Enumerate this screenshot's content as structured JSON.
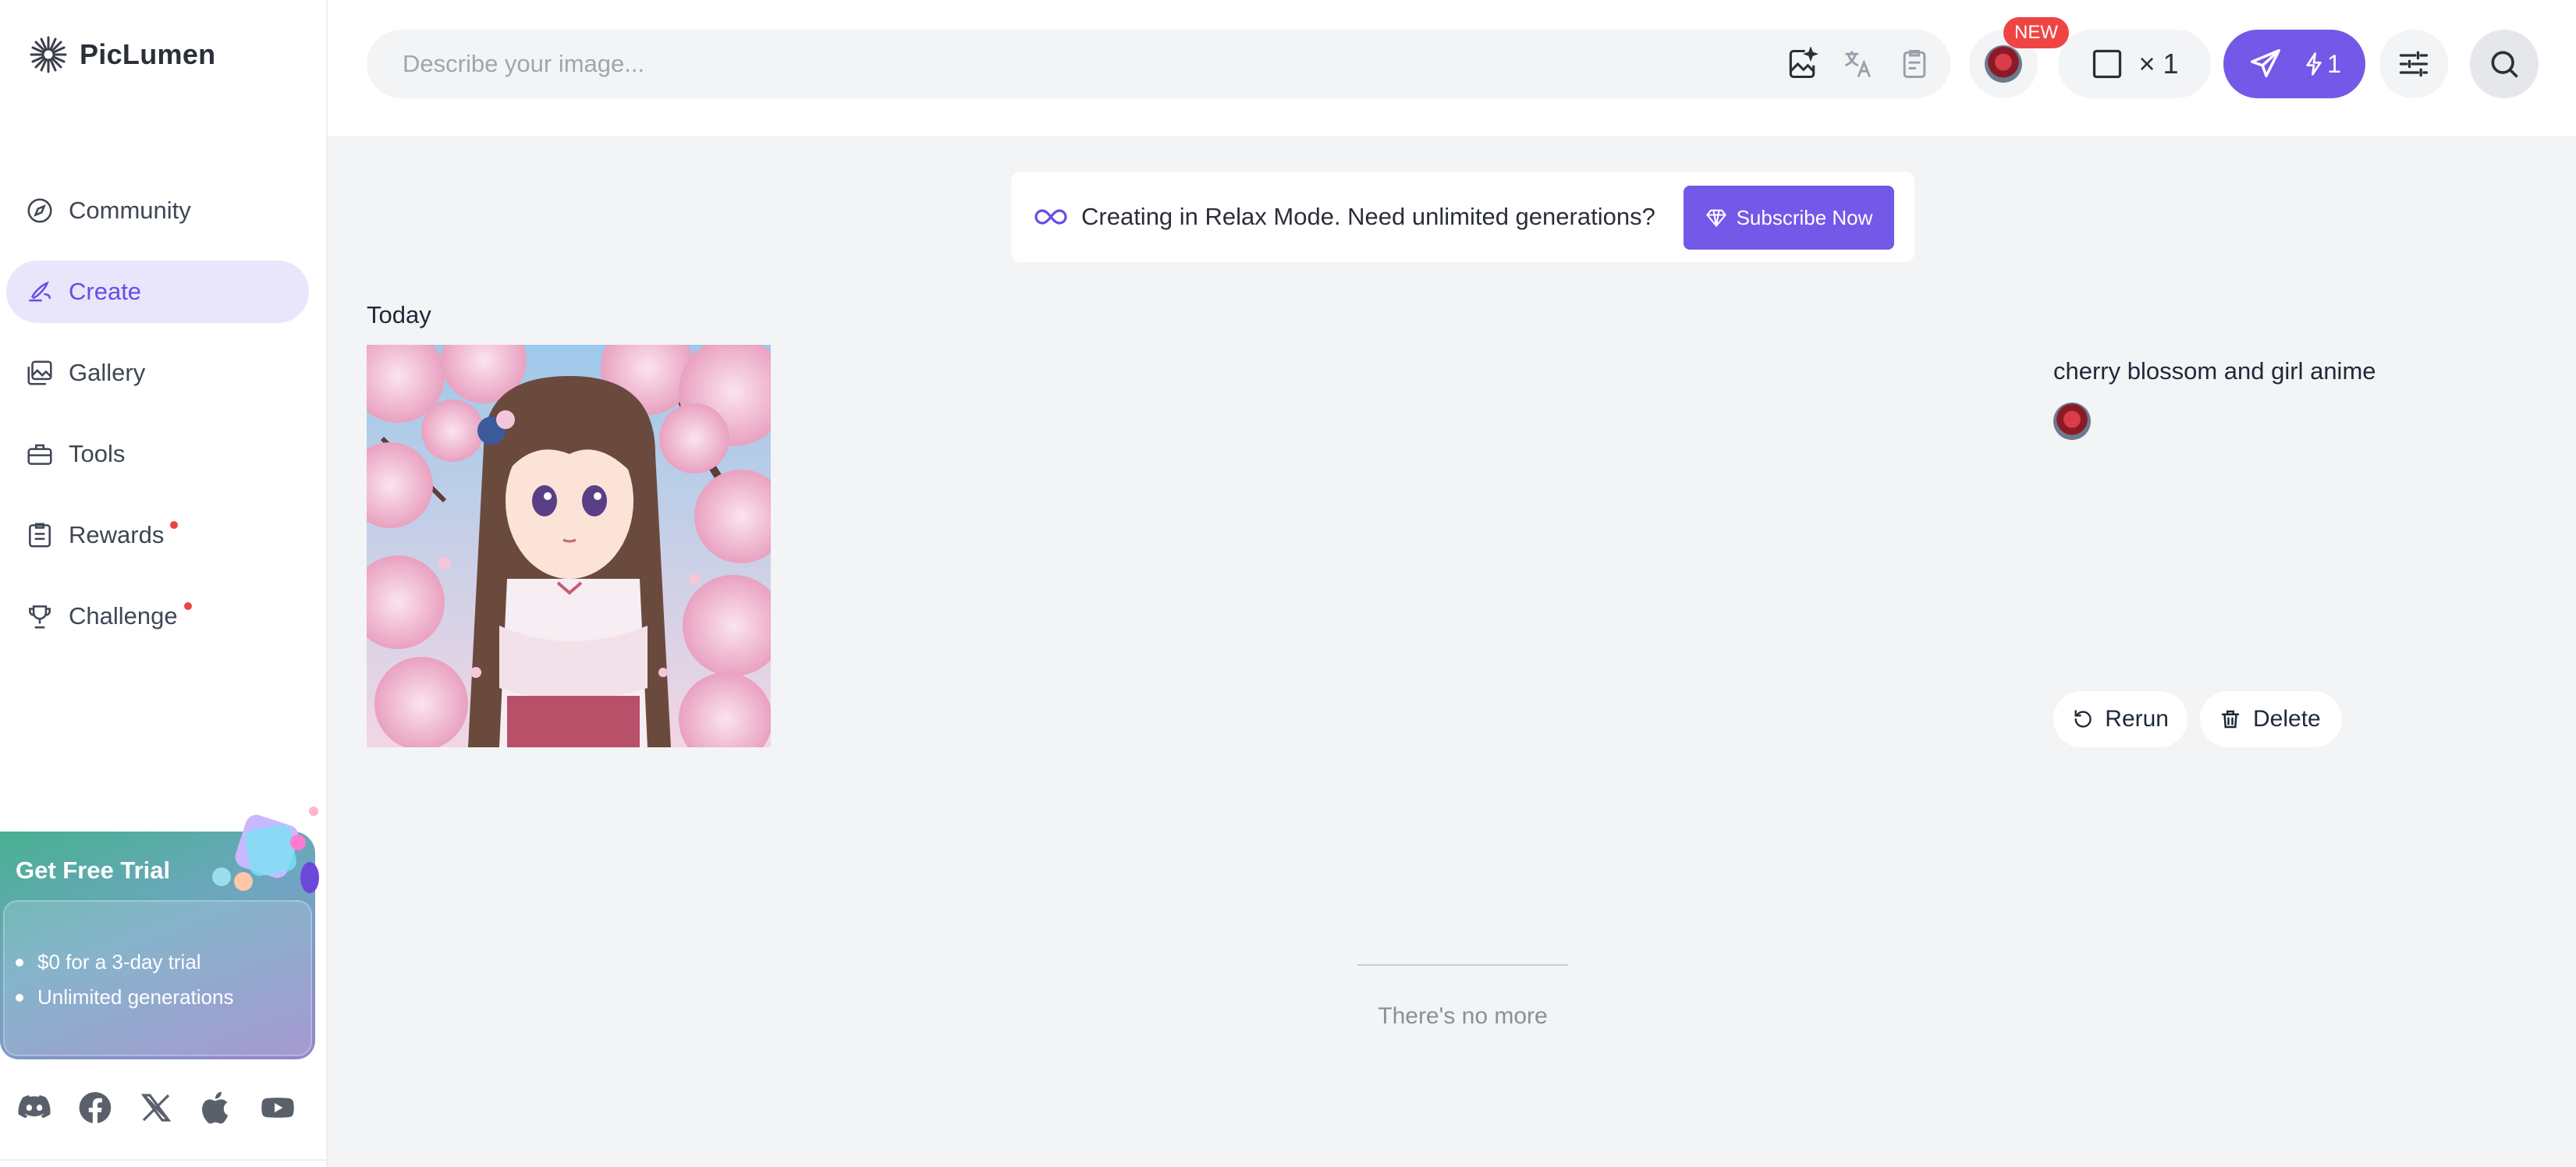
{
  "app": {
    "name": "PicLumen"
  },
  "sidebar": {
    "items": [
      {
        "label": "Community",
        "icon": "compass-icon",
        "active": false
      },
      {
        "label": "Create",
        "icon": "brush-icon",
        "active": true
      },
      {
        "label": "Gallery",
        "icon": "images-icon",
        "active": false
      },
      {
        "label": "Tools",
        "icon": "toolbox-icon",
        "active": false
      },
      {
        "label": "Rewards",
        "icon": "clipboard-icon",
        "active": false,
        "notification": true
      },
      {
        "label": "Challenge",
        "icon": "trophy-icon",
        "active": false,
        "notification": true
      }
    ],
    "trial": {
      "title": "Get Free Trial",
      "points": [
        "$0 for a 3-day trial",
        "Unlimited generations"
      ]
    },
    "socials": [
      "discord-icon",
      "facebook-icon",
      "x-icon",
      "apple-icon",
      "youtube-icon"
    ]
  },
  "topbar": {
    "search_placeholder": "Describe your image...",
    "badge": "NEW",
    "batch_count": "× 1",
    "generate_cost": "1"
  },
  "banner": {
    "text": "Creating in Relax Mode. Need unlimited generations?",
    "button": "Subscribe Now"
  },
  "feed": {
    "section_label": "Today",
    "prompt": "cherry blossom and girl anime",
    "rerun_label": "Rerun",
    "delete_label": "Delete",
    "end_text": "There's no more"
  },
  "colors": {
    "accent": "#7458e8",
    "active_bg": "#e9e6fb",
    "badge": "#ef4444",
    "page_bg": "#f3f4f6"
  }
}
